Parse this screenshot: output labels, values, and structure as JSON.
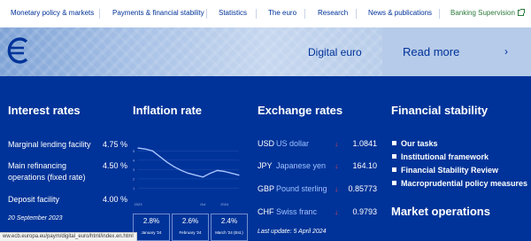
{
  "nav": {
    "items": [
      "Monetary policy & markets",
      "Payments & financial stability",
      "Statistics",
      "The euro",
      "Research",
      "News & publications"
    ],
    "banking_supervision": "Banking Supervision"
  },
  "banner": {
    "title": "Digital euro",
    "read_more": "Read more",
    "logo_icon": "euro-icon",
    "chevron_icon": "chevron-right-icon"
  },
  "interest_rates": {
    "title": "Interest rates",
    "rows": [
      {
        "label": "Marginal lending facility",
        "value": "4.75 %"
      },
      {
        "label": "Main refinancing operations (fixed rate)",
        "value": "4.50 %"
      },
      {
        "label": "Deposit facility",
        "value": "4.00 %"
      }
    ],
    "date": "20 September 2023"
  },
  "inflation": {
    "title": "Inflation rate",
    "boxes": [
      {
        "value": "2.8%",
        "label": "January '24"
      },
      {
        "value": "2.6%",
        "label": "February '24"
      },
      {
        "value": "2.4%",
        "label": "March '24 (Est.)"
      }
    ]
  },
  "chart_data": {
    "type": "line",
    "x_tick_labels": [
      "2023",
      "Oct",
      "2024"
    ],
    "y_tick_labels": [
      "5",
      "4",
      "3",
      "2",
      "1"
    ],
    "ylim": [
      0,
      5.5
    ],
    "x": [
      "2023-01",
      "2023-02",
      "2023-03",
      "2023-04",
      "2023-05",
      "2023-06",
      "2023-07",
      "2023-08",
      "2023-09",
      "2023-10",
      "2023-11",
      "2023-12",
      "2024-01",
      "2024-02",
      "2024-03"
    ],
    "values": [
      5.3,
      5.2,
      5.0,
      4.4,
      3.8,
      3.3,
      2.9,
      2.6,
      2.4,
      2.2,
      2.6,
      2.9,
      2.8,
      2.6,
      2.4
    ],
    "line_color": "#a8c4ff"
  },
  "exchange": {
    "title": "Exchange rates",
    "rows": [
      {
        "code": "USD",
        "name": "US dollar",
        "value": "1.0841"
      },
      {
        "code": "JPY",
        "name": "Japanese yen",
        "value": "164.10"
      },
      {
        "code": "GBP",
        "name": "Pound sterling",
        "value": "0.85773"
      },
      {
        "code": "CHF",
        "name": "Swiss franc",
        "value": "0.9793"
      }
    ],
    "arrow_icon": "arrow-down-icon",
    "arrow_color": "#e8464d",
    "updated": "Last update: 5 April 2024"
  },
  "financial_stability": {
    "title": "Financial stability",
    "items": [
      "Our tasks",
      "Institutional framework",
      "Financial Stability Review",
      "Macroprudential policy measures"
    ]
  },
  "market_operations": {
    "title": "Market operations"
  },
  "status_url": "ww.ecb.europa.eu/paym/digital_euro/html/index.en.html",
  "colors": {
    "brand_blue": "#003399",
    "link_blue": "#003299",
    "banner_blue": "#9fb9e0",
    "green": "#2b7a3a"
  }
}
